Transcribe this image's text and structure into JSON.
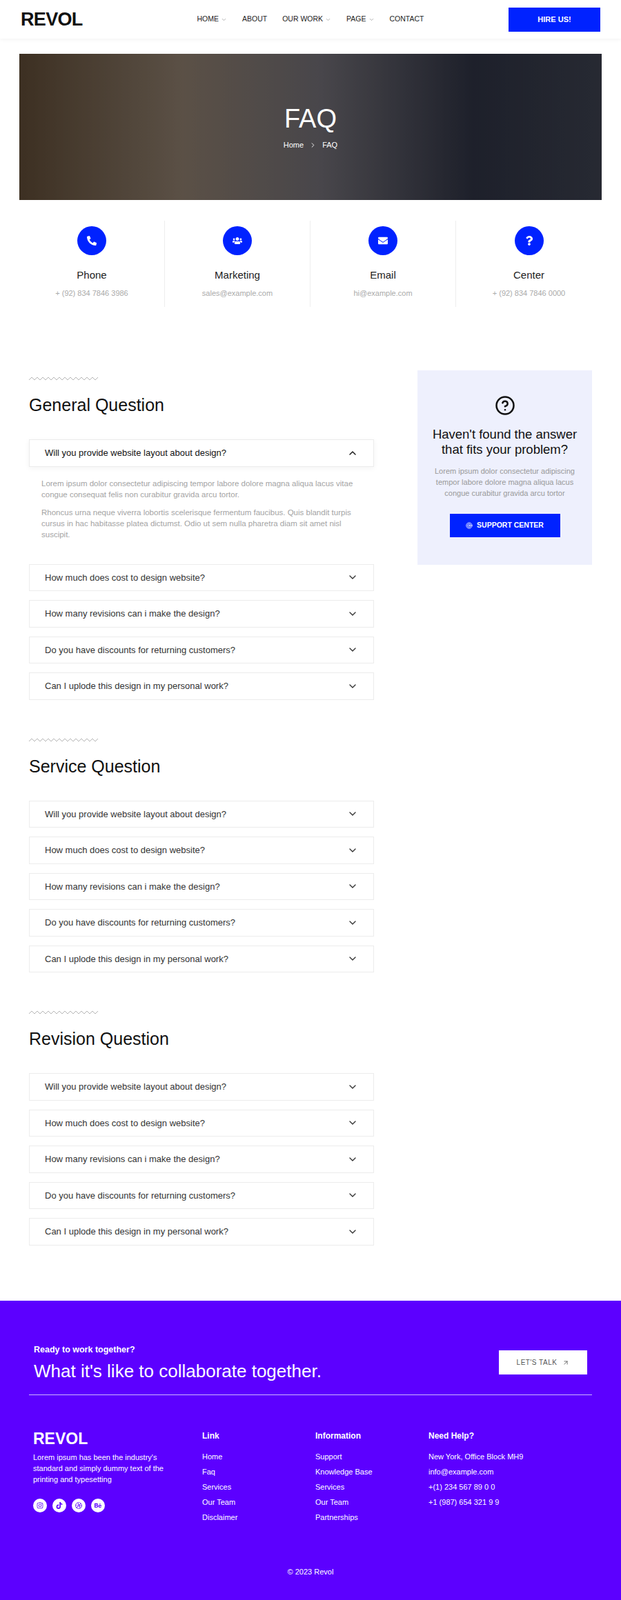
{
  "nav": {
    "logo": "REVOL",
    "items": [
      {
        "label": "HOME",
        "dropdown": true
      },
      {
        "label": "ABOUT",
        "dropdown": false
      },
      {
        "label": "OUR WORK",
        "dropdown": true
      },
      {
        "label": "PAGE",
        "dropdown": true
      },
      {
        "label": "CONTACT",
        "dropdown": false
      }
    ],
    "cta": "HIRE US!"
  },
  "hero": {
    "title": "FAQ",
    "breadcrumb": [
      "Home",
      "FAQ"
    ]
  },
  "contacts": [
    {
      "title": "Phone",
      "value": "+ (92) 834 7846 3986"
    },
    {
      "title": "Marketing",
      "value": "sales@example.com"
    },
    {
      "title": "Email",
      "value": "hi@example.com"
    },
    {
      "title": "Center",
      "value": "+ (92) 834 7846 0000"
    }
  ],
  "sections": [
    {
      "title": "General Question",
      "items": [
        {
          "question": "Will you provide website layout about design?",
          "expanded": true,
          "answer": [
            "Lorem ipsum dolor consectetur adipiscing tempor labore dolore magna aliqua lacus vitae congue consequat felis non curabitur gravida arcu tortor.",
            "Rhoncus urna neque viverra lobortis scelerisque fermentum faucibus. Quis blandit turpis cursus in hac habitasse platea dictumst. Odio ut sem nulla pharetra diam sit amet nisl suscipit."
          ]
        },
        {
          "question": "How much does cost to design website?",
          "expanded": false
        },
        {
          "question": "How many revisions can i make the design?",
          "expanded": false
        },
        {
          "question": "Do you have discounts for returning customers?",
          "expanded": false
        },
        {
          "question": "Can I uplode this design in my personal work?",
          "expanded": false
        }
      ]
    },
    {
      "title": "Service Question",
      "items": [
        {
          "question": "Will you provide website layout about design?",
          "expanded": false
        },
        {
          "question": "How much does cost to design website?",
          "expanded": false
        },
        {
          "question": "How many revisions can i make the design?",
          "expanded": false
        },
        {
          "question": "Do you have discounts for returning customers?",
          "expanded": false
        },
        {
          "question": "Can I uplode this design in my personal work?",
          "expanded": false
        }
      ]
    },
    {
      "title": "Revision Question",
      "items": [
        {
          "question": "Will you provide website layout about design?",
          "expanded": false
        },
        {
          "question": "How much does cost to design website?",
          "expanded": false
        },
        {
          "question": "How many revisions can i make the design?",
          "expanded": false
        },
        {
          "question": "Do you have discounts for returning customers?",
          "expanded": false
        },
        {
          "question": "Can I uplode this design in my personal work?",
          "expanded": false
        }
      ]
    }
  ],
  "sidebar": {
    "title": "Haven't found the answer that fits your problem?",
    "text": "Lorem ipsum dolor consectetur adipiscing tempor labore dolore magna aliqua lacus congue curabitur gravida arcu tortor",
    "button": "SUPPORT CENTER"
  },
  "footer": {
    "eyebrow": "Ready to work together?",
    "headline": "What it's like to collaborate together.",
    "cta": "LET'S TALK",
    "logo": "REVOL",
    "about": "Lorem ipsum has been the industry's standard and simply dummy text of the printing and typesetting",
    "columns": [
      {
        "title": "Link",
        "links": [
          "Home",
          "Faq",
          "Services",
          "Our Team",
          "Disclaimer"
        ]
      },
      {
        "title": "Information",
        "links": [
          "Support",
          "Knowledge Base",
          "Services",
          "Our Team",
          "Partnerships"
        ]
      },
      {
        "title": "Need Help?",
        "links": [
          "New York, Office Block MH9",
          "info@example.com",
          "+(1) 234 567 89 0 0",
          "+1 (987) 654 321 9 9"
        ]
      }
    ],
    "copyright": "© 2023 Revol"
  }
}
